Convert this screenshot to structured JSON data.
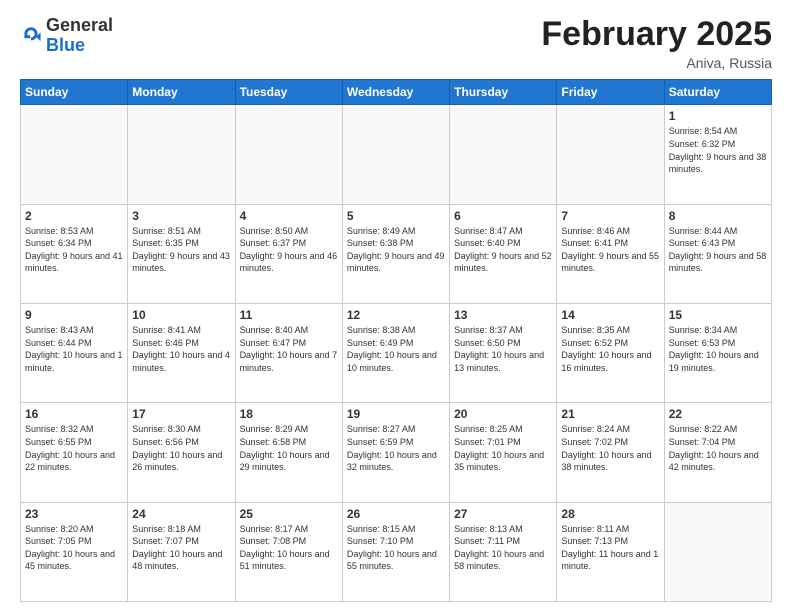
{
  "header": {
    "logo_general": "General",
    "logo_blue": "Blue",
    "month_title": "February 2025",
    "location": "Aniva, Russia"
  },
  "weekdays": [
    "Sunday",
    "Monday",
    "Tuesday",
    "Wednesday",
    "Thursday",
    "Friday",
    "Saturday"
  ],
  "weeks": [
    [
      {
        "day": "",
        "info": ""
      },
      {
        "day": "",
        "info": ""
      },
      {
        "day": "",
        "info": ""
      },
      {
        "day": "",
        "info": ""
      },
      {
        "day": "",
        "info": ""
      },
      {
        "day": "",
        "info": ""
      },
      {
        "day": "1",
        "info": "Sunrise: 8:54 AM\nSunset: 6:32 PM\nDaylight: 9 hours\nand 38 minutes."
      }
    ],
    [
      {
        "day": "2",
        "info": "Sunrise: 8:53 AM\nSunset: 6:34 PM\nDaylight: 9 hours\nand 41 minutes."
      },
      {
        "day": "3",
        "info": "Sunrise: 8:51 AM\nSunset: 6:35 PM\nDaylight: 9 hours\nand 43 minutes."
      },
      {
        "day": "4",
        "info": "Sunrise: 8:50 AM\nSunset: 6:37 PM\nDaylight: 9 hours\nand 46 minutes."
      },
      {
        "day": "5",
        "info": "Sunrise: 8:49 AM\nSunset: 6:38 PM\nDaylight: 9 hours\nand 49 minutes."
      },
      {
        "day": "6",
        "info": "Sunrise: 8:47 AM\nSunset: 6:40 PM\nDaylight: 9 hours\nand 52 minutes."
      },
      {
        "day": "7",
        "info": "Sunrise: 8:46 AM\nSunset: 6:41 PM\nDaylight: 9 hours\nand 55 minutes."
      },
      {
        "day": "8",
        "info": "Sunrise: 8:44 AM\nSunset: 6:43 PM\nDaylight: 9 hours\nand 58 minutes."
      }
    ],
    [
      {
        "day": "9",
        "info": "Sunrise: 8:43 AM\nSunset: 6:44 PM\nDaylight: 10 hours\nand 1 minute."
      },
      {
        "day": "10",
        "info": "Sunrise: 8:41 AM\nSunset: 6:46 PM\nDaylight: 10 hours\nand 4 minutes."
      },
      {
        "day": "11",
        "info": "Sunrise: 8:40 AM\nSunset: 6:47 PM\nDaylight: 10 hours\nand 7 minutes."
      },
      {
        "day": "12",
        "info": "Sunrise: 8:38 AM\nSunset: 6:49 PM\nDaylight: 10 hours\nand 10 minutes."
      },
      {
        "day": "13",
        "info": "Sunrise: 8:37 AM\nSunset: 6:50 PM\nDaylight: 10 hours\nand 13 minutes."
      },
      {
        "day": "14",
        "info": "Sunrise: 8:35 AM\nSunset: 6:52 PM\nDaylight: 10 hours\nand 16 minutes."
      },
      {
        "day": "15",
        "info": "Sunrise: 8:34 AM\nSunset: 6:53 PM\nDaylight: 10 hours\nand 19 minutes."
      }
    ],
    [
      {
        "day": "16",
        "info": "Sunrise: 8:32 AM\nSunset: 6:55 PM\nDaylight: 10 hours\nand 22 minutes."
      },
      {
        "day": "17",
        "info": "Sunrise: 8:30 AM\nSunset: 6:56 PM\nDaylight: 10 hours\nand 26 minutes."
      },
      {
        "day": "18",
        "info": "Sunrise: 8:29 AM\nSunset: 6:58 PM\nDaylight: 10 hours\nand 29 minutes."
      },
      {
        "day": "19",
        "info": "Sunrise: 8:27 AM\nSunset: 6:59 PM\nDaylight: 10 hours\nand 32 minutes."
      },
      {
        "day": "20",
        "info": "Sunrise: 8:25 AM\nSunset: 7:01 PM\nDaylight: 10 hours\nand 35 minutes."
      },
      {
        "day": "21",
        "info": "Sunrise: 8:24 AM\nSunset: 7:02 PM\nDaylight: 10 hours\nand 38 minutes."
      },
      {
        "day": "22",
        "info": "Sunrise: 8:22 AM\nSunset: 7:04 PM\nDaylight: 10 hours\nand 42 minutes."
      }
    ],
    [
      {
        "day": "23",
        "info": "Sunrise: 8:20 AM\nSunset: 7:05 PM\nDaylight: 10 hours\nand 45 minutes."
      },
      {
        "day": "24",
        "info": "Sunrise: 8:18 AM\nSunset: 7:07 PM\nDaylight: 10 hours\nand 48 minutes."
      },
      {
        "day": "25",
        "info": "Sunrise: 8:17 AM\nSunset: 7:08 PM\nDaylight: 10 hours\nand 51 minutes."
      },
      {
        "day": "26",
        "info": "Sunrise: 8:15 AM\nSunset: 7:10 PM\nDaylight: 10 hours\nand 55 minutes."
      },
      {
        "day": "27",
        "info": "Sunrise: 8:13 AM\nSunset: 7:11 PM\nDaylight: 10 hours\nand 58 minutes."
      },
      {
        "day": "28",
        "info": "Sunrise: 8:11 AM\nSunset: 7:13 PM\nDaylight: 11 hours\nand 1 minute."
      },
      {
        "day": "",
        "info": ""
      }
    ]
  ]
}
